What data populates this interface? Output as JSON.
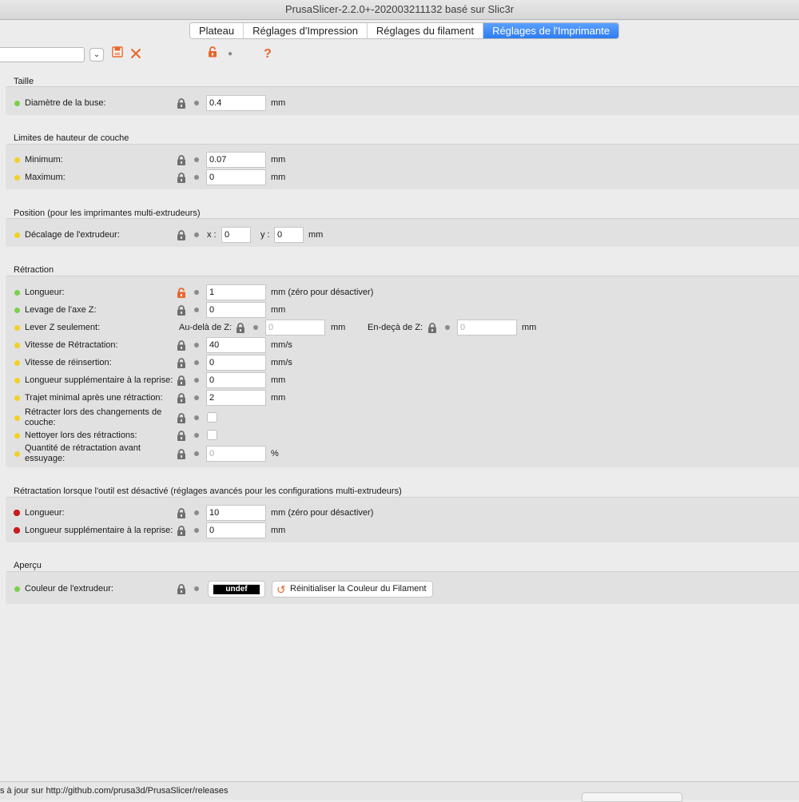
{
  "window": {
    "title": "PrusaSlicer-2.2.0+-202003211132 basé sur Slic3r"
  },
  "tabs": [
    {
      "label": "Plateau"
    },
    {
      "label": "Réglages d'Impression"
    },
    {
      "label": "Réglages du filament"
    },
    {
      "label": "Réglages de l'Imprimante"
    }
  ],
  "toolbar": {
    "save_icon": "save-icon",
    "delete_icon": "close-icon",
    "lock_icon": "lock-open-icon",
    "help_label": "?"
  },
  "sections": {
    "taille": {
      "title": "Taille",
      "nozzle": {
        "label": "Diamètre de la buse:",
        "value": "0.4",
        "unit": "mm"
      }
    },
    "layer_limits": {
      "title": "Limites de hauteur de couche",
      "min": {
        "label": "Minimum:",
        "value": "0.07",
        "unit": "mm"
      },
      "max": {
        "label": "Maximum:",
        "value": "0",
        "unit": "mm"
      }
    },
    "position": {
      "title": "Position (pour les imprimantes multi-extrudeurs)",
      "offset": {
        "label": "Décalage de l'extrudeur:",
        "x_label": "x :",
        "x_value": "0",
        "y_label": "y :",
        "y_value": "0",
        "unit": "mm"
      }
    },
    "retraction": {
      "title": "Rétraction",
      "length": {
        "label": "Longueur:",
        "value": "1",
        "unit": "mm (zéro pour désactiver)"
      },
      "lift_z": {
        "label": "Levage de l'axe Z:",
        "value": "0",
        "unit": "mm"
      },
      "only_lift": {
        "label": "Lever Z seulement:",
        "above_label": "Au-delà de Z:",
        "above_value": "0",
        "above_unit": "mm",
        "below_label": "En-deçà de Z:",
        "below_value": "0",
        "below_unit": "mm"
      },
      "speed": {
        "label": "Vitesse de Rétractation:",
        "value": "40",
        "unit": "mm/s"
      },
      "deretract_speed": {
        "label": "Vitesse de réinsertion:",
        "value": "0",
        "unit": "mm/s"
      },
      "restart_extra": {
        "label": "Longueur supplémentaire à la reprise:",
        "value": "0",
        "unit": "mm"
      },
      "min_travel": {
        "label": "Trajet minimal après une rétraction:",
        "value": "2",
        "unit": "mm"
      },
      "layer_change": {
        "label": "Rétracter lors des changements de couche:"
      },
      "wipe": {
        "label": "Nettoyer lors des rétractions:"
      },
      "before_wipe": {
        "label": "Quantité de rétractation avant essuyage:",
        "value": "0",
        "unit": "%"
      }
    },
    "tool_change": {
      "title": "Rétractation lorsque l'outil est désactivé (réglages avancés pour les configurations multi-extrudeurs)",
      "length": {
        "label": "Longueur:",
        "value": "10",
        "unit": "mm (zéro pour désactiver)"
      },
      "restart_extra": {
        "label": "Longueur supplémentaire à la reprise:",
        "value": "0",
        "unit": "mm"
      }
    },
    "preview": {
      "title": "Aperçu",
      "color": {
        "label": "Couleur de l'extrudeur:",
        "swatch_text": "undef",
        "reset_label": "Réinitialiser la Couleur du Filament"
      }
    }
  },
  "statusbar": {
    "text": "s à jour sur http://github.com/prusa3d/PrusaSlicer/releases"
  },
  "colors": {
    "accent": "#2f7cf0",
    "orange": "#e8662a",
    "green_dot": "#7ad04a",
    "yellow_dot": "#f1d027",
    "red_dot": "#c81e1e"
  }
}
